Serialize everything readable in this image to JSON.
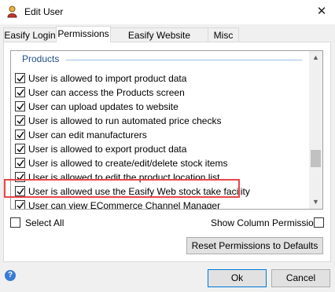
{
  "window": {
    "title": "Edit User"
  },
  "tabs": [
    {
      "label": "Easify Login"
    },
    {
      "label": "Permissions"
    },
    {
      "label": "Easify Website Account"
    },
    {
      "label": "Misc"
    }
  ],
  "permissions": {
    "group_title": "Products",
    "items": [
      {
        "label": "User is allowed to import product data",
        "checked": true
      },
      {
        "label": "User can access the Products screen",
        "checked": true
      },
      {
        "label": "User can upload updates to website",
        "checked": true
      },
      {
        "label": "User is allowed to run automated price checks",
        "checked": true
      },
      {
        "label": "User can edit manufacturers",
        "checked": true
      },
      {
        "label": "User is allowed to export product data",
        "checked": true
      },
      {
        "label": "User is allowed to create/edit/delete stock items",
        "checked": true
      },
      {
        "label": "User is allowed to edit the product location list",
        "checked": true
      },
      {
        "label": "User is allowed use the Easify Web stock take facility",
        "checked": true
      },
      {
        "label": "User can view ECommerce Channel Manager",
        "checked": true
      }
    ]
  },
  "options": {
    "select_all_label": "Select All",
    "show_columns_label": "Show Column Permissions"
  },
  "buttons": {
    "reset": "Reset Permissions to Defaults",
    "ok": "Ok",
    "cancel": "Cancel"
  },
  "colors": {
    "highlight": "#e8474a",
    "group_title": "#1e4e8c"
  }
}
